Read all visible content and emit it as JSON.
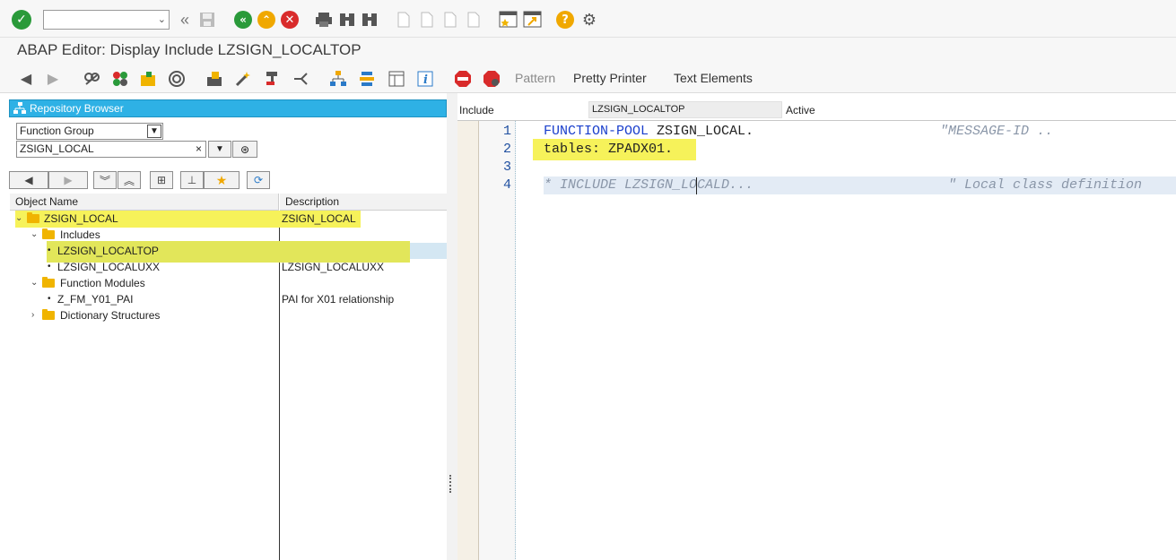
{
  "window": {
    "title": "ABAP Editor: Display Include LZSIGN_LOCALTOP"
  },
  "system_toolbar": {
    "command_field": {
      "value": "",
      "placeholder": ""
    },
    "icons": [
      "enter-icon",
      "back-double-icon",
      "save-icon",
      "back-icon",
      "exit-icon",
      "cancel-icon",
      "print-icon",
      "find-icon",
      "find-next-icon",
      "first-page-icon",
      "previous-page-icon",
      "next-page-icon",
      "last-page-icon",
      "create-session-icon",
      "generate-shortcut-icon",
      "help-icon",
      "settings-icon"
    ]
  },
  "app_toolbar": {
    "pattern_label": "Pattern",
    "pretty_printer_label": "Pretty Printer",
    "text_elements_label": "Text Elements"
  },
  "repository_browser": {
    "title": "Repository Browser",
    "object_type": "Function Group",
    "object_name": "ZSIGN_LOCAL",
    "columns": {
      "name": "Object Name",
      "description": "Description"
    },
    "tree": [
      {
        "name": "ZSIGN_LOCAL",
        "description": "ZSIGN_LOCAL",
        "level": 0,
        "expanded": true,
        "type": "folder",
        "highlighted": true
      },
      {
        "name": "Includes",
        "description": "",
        "level": 1,
        "expanded": true,
        "type": "folder"
      },
      {
        "name": "LZSIGN_LOCALTOP",
        "description": "",
        "level": 2,
        "type": "leaf",
        "selected": true,
        "highlighted": true
      },
      {
        "name": "LZSIGN_LOCALUXX",
        "description": "LZSIGN_LOCALUXX",
        "level": 2,
        "type": "leaf"
      },
      {
        "name": "Function Modules",
        "description": "",
        "level": 1,
        "expanded": true,
        "type": "folder"
      },
      {
        "name": "Z_FM_Y01_PAI",
        "description": "PAI for X01 relationship",
        "level": 2,
        "type": "leaf"
      },
      {
        "name": "Dictionary Structures",
        "description": "",
        "level": 1,
        "expanded": false,
        "type": "folder"
      }
    ]
  },
  "editor": {
    "include_label": "Include",
    "include_name": "LZSIGN_LOCALTOP",
    "status": "Active",
    "lines": [
      {
        "num": "1",
        "part1": "FUNCTION-POOL",
        "part2": " ZSIGN_LOCAL.",
        "comment": "\"MESSAGE-ID .."
      },
      {
        "num": "2",
        "text": "tables: ZPADX01."
      },
      {
        "num": "3",
        "text": ""
      },
      {
        "num": "4",
        "comment1": "* INCLUDE LZSIGN_LOCALD...",
        "comment2": "\" Local class definition"
      }
    ]
  },
  "colors": {
    "browser_header": "#2eb1e5",
    "highlight": "#f6f25a",
    "keyword": "#1a3fcc",
    "comment": "#8a96a8"
  }
}
